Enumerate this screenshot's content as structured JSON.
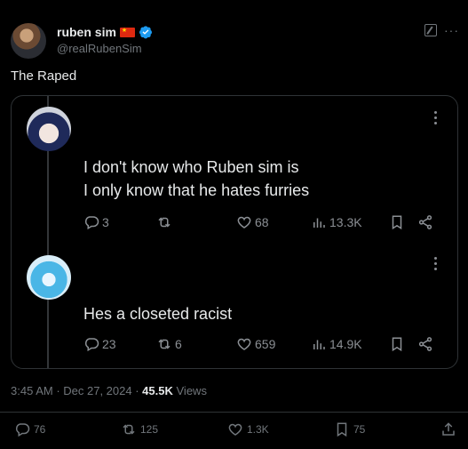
{
  "author": {
    "display_name": "ruben sim",
    "handle": "@realRubenSim"
  },
  "tweet": {
    "text": "The Raped",
    "time": "3:45 AM",
    "date": "Dec 27, 2024",
    "views_count": "45.5K",
    "views_label": "Views"
  },
  "embedded": {
    "comments": [
      {
        "line1": "I  don't know who Ruben sim is",
        "line2": "I only know that he hates furries",
        "replies": "3",
        "retweets": "",
        "likes": "68",
        "views": "13.3K"
      },
      {
        "line1": "Hes a closeted racist",
        "replies": "23",
        "retweets": "6",
        "likes": "659",
        "views": "14.9K"
      }
    ]
  },
  "actions": {
    "replies": "76",
    "reposts": "125",
    "likes": "1.3K",
    "bookmarks": "75"
  },
  "colors": {
    "background": "#000000",
    "text": "#e7e9ea",
    "muted": "#71767b",
    "verified": "#1d9bf0",
    "flag": "#de2910"
  }
}
